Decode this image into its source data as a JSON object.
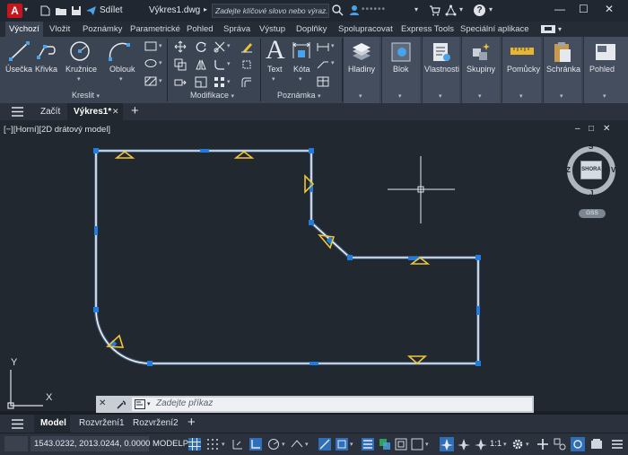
{
  "app": {
    "logo_letter": "A",
    "share_label": "Sdílet",
    "file_name": "Výkres1.dwg",
    "search_placeholder": "Zadejte klíčové slovo nebo výraz.",
    "user_name": "••••••",
    "help_label": "?"
  },
  "ribbon_tabs": [
    "Výchozí",
    "Vložit",
    "Poznámky",
    "Parametrické",
    "Pohled",
    "Správa",
    "Výstup",
    "Doplňky",
    "Spolupracovat",
    "Express Tools",
    "Speciální aplikace"
  ],
  "ribbon": {
    "draw": {
      "title": "Kreslit",
      "buttons": [
        "Úsečka",
        "Křivka",
        "Kružnice",
        "Oblouk"
      ]
    },
    "modify": {
      "title": "Modifikace"
    },
    "annotation": {
      "title": "Poznámka",
      "buttons": [
        "Text",
        "Kóta"
      ]
    },
    "big_buttons": [
      "Hladiny",
      "Blok",
      "Vlastnosti",
      "Skupiny",
      "Pomůcky",
      "Schránka",
      "Pohled"
    ]
  },
  "doc_tabs": {
    "start": "Začít",
    "active": "Výkres1*"
  },
  "viewport": {
    "label": "[−][Horní][2D drátový model]",
    "window_ctrl_min": "–",
    "window_ctrl_max": "□",
    "window_ctrl_close": "✕",
    "viewcube": {
      "north": "S",
      "south": "J",
      "east": "V",
      "west": "Z",
      "face": "SHORA",
      "wcs": "GSS"
    },
    "ucs_x": "X",
    "ucs_y": "Y"
  },
  "command_line": {
    "placeholder": "Zadejte příkaz"
  },
  "layout_tabs": [
    "Model",
    "Rozvržení1",
    "Rozvržení2"
  ],
  "status": {
    "coordinates": "1543.0232, 2013.0244, 0.0000",
    "mode": "MODELP",
    "scale": "1:1"
  },
  "colors": {
    "accent": "#1e7ed1",
    "geometry": "#e8edf5",
    "grip": "#1f7de0",
    "constraint": "#f0c43a"
  }
}
